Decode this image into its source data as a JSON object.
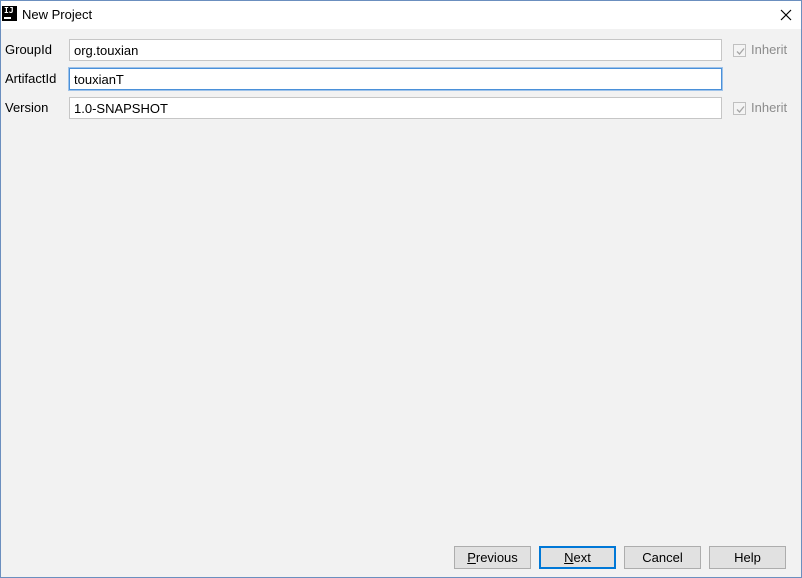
{
  "window": {
    "title": "New Project",
    "app_icon_text": "IJ"
  },
  "fields": [
    {
      "label": "GroupId",
      "value": "org.touxian",
      "inherit_label": "Inherit",
      "inherit_checked": true
    },
    {
      "label": "ArtifactId",
      "value": "touxianT",
      "focused": true
    },
    {
      "label": "Version",
      "value": "1.0-SNAPSHOT",
      "inherit_label": "Inherit",
      "inherit_checked": true
    }
  ],
  "buttons": {
    "previous": {
      "mnemonic": "P",
      "rest": "revious"
    },
    "next": {
      "mnemonic": "N",
      "rest": "ext"
    },
    "cancel": "Cancel",
    "help": "Help"
  },
  "colors": {
    "focus_border": "#4a90d9",
    "default_button_border": "#0078d7",
    "dialog_background": "#f2f2f2"
  }
}
